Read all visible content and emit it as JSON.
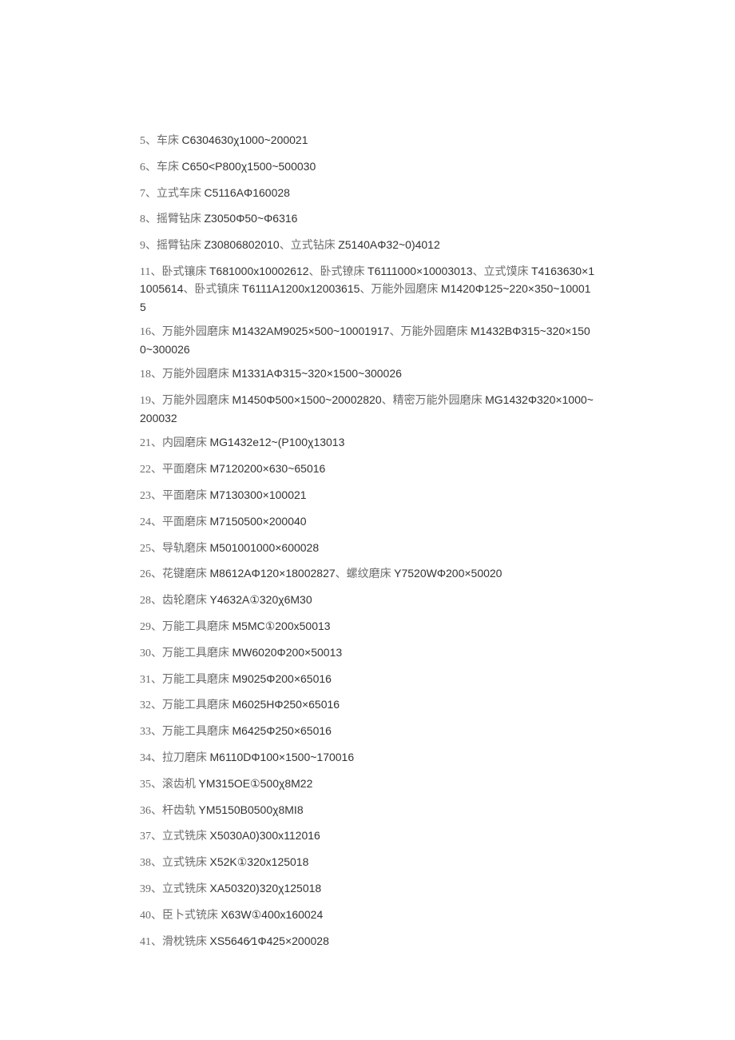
{
  "items": [
    [
      [
        "cn",
        "5、车床 "
      ],
      [
        "latin",
        "C6304630χ1000~200021"
      ]
    ],
    [
      [
        "cn",
        "6、车床 "
      ],
      [
        "latin",
        "C650<P800χ1500~500030"
      ]
    ],
    [
      [
        "cn",
        "7、立式车床 "
      ],
      [
        "latin",
        "C5116AΦ160028"
      ]
    ],
    [
      [
        "cn",
        "8、摇臂钻床 "
      ],
      [
        "latin",
        "Z3050Φ50~Φ6316"
      ]
    ],
    [
      [
        "cn",
        "9、摇臂钻床 "
      ],
      [
        "latin",
        "Z30806802010"
      ],
      [
        "cn",
        "、立式钻床 "
      ],
      [
        "latin",
        "Z5140AΦ32~0)4012"
      ]
    ],
    [
      [
        "cn",
        "11、卧式镶床 "
      ],
      [
        "latin",
        "T681000x10002612"
      ],
      [
        "cn",
        "、卧式镣床 "
      ],
      [
        "latin",
        "T6111000×10003013"
      ],
      [
        "cn",
        "、立式馍床 "
      ],
      [
        "latin",
        "T4163630×11005614"
      ],
      [
        "cn",
        "、卧式镇床 "
      ],
      [
        "latin",
        "T6111A1200x12003615"
      ],
      [
        "cn",
        "、万能外园磨床 "
      ],
      [
        "latin",
        "M1420Φ125~220×350~100015"
      ]
    ],
    [
      [
        "cn",
        "16、万能外园磨床 "
      ],
      [
        "latin",
        "M1432AM9025×500~10001917"
      ],
      [
        "cn",
        "、万能外园磨床 "
      ],
      [
        "latin",
        "M1432BΦ315~320×1500~300026"
      ]
    ],
    [
      [
        "cn",
        "18、万能外园磨床 "
      ],
      [
        "latin",
        "M1331AΦ315~320×1500~300026"
      ]
    ],
    [
      [
        "cn",
        "19、万能外园磨床 "
      ],
      [
        "latin",
        "M1450Φ500×1500~20002820"
      ],
      [
        "cn",
        "、精密万能外园磨床 "
      ],
      [
        "latin",
        "MG1432Φ320×1000~200032"
      ]
    ],
    [
      [
        "cn",
        "21、内园磨床 "
      ],
      [
        "latin",
        "MG1432e12~(P100χ13013"
      ]
    ],
    [
      [
        "cn",
        "22、平面磨床 "
      ],
      [
        "latin",
        "M7120200×630~65016"
      ]
    ],
    [
      [
        "cn",
        "23、平面磨床 "
      ],
      [
        "latin",
        "M7130300×100021"
      ]
    ],
    [
      [
        "cn",
        "24、平面磨床 "
      ],
      [
        "latin",
        "M7150500×200040"
      ]
    ],
    [
      [
        "cn",
        "25、导轨磨床 "
      ],
      [
        "latin",
        "M501001000×600028"
      ]
    ],
    [
      [
        "cn",
        "26、花键磨床 "
      ],
      [
        "latin",
        "M8612AΦ120×18002827"
      ],
      [
        "cn",
        "、螺纹磨床 "
      ],
      [
        "latin",
        "Y7520WΦ200×50020"
      ]
    ],
    [
      [
        "cn",
        "28、齿轮磨床 "
      ],
      [
        "latin",
        "Y4632A①320χ6M30"
      ]
    ],
    [
      [
        "cn",
        "29、万能工具磨床 "
      ],
      [
        "latin",
        "M5MC①200x50013"
      ]
    ],
    [
      [
        "cn",
        "30、万能工具磨床 "
      ],
      [
        "latin",
        "MW6020Φ200×50013"
      ]
    ],
    [
      [
        "cn",
        "31、万能工具磨床 "
      ],
      [
        "latin",
        "M9025Φ200×65016"
      ]
    ],
    [
      [
        "cn",
        "32、万能工具磨床 "
      ],
      [
        "latin",
        "M6025HΦ250×65016"
      ]
    ],
    [
      [
        "cn",
        "33、万能工具磨床 "
      ],
      [
        "latin",
        "M6425Φ250×65016"
      ]
    ],
    [
      [
        "cn",
        "34、拉刀磨床 "
      ],
      [
        "latin",
        "M6110DΦ100×1500~170016"
      ]
    ],
    [
      [
        "cn",
        "35、滚齿机 "
      ],
      [
        "latin",
        "YM315OE①500χ8M22"
      ]
    ],
    [
      [
        "cn",
        "36、杆齿轨 "
      ],
      [
        "latin",
        "YM5150B0500χ8MI8"
      ]
    ],
    [
      [
        "cn",
        "37、立式铣床 "
      ],
      [
        "latin",
        "X5030A0)300x112016"
      ]
    ],
    [
      [
        "cn",
        "38、立式铣床 "
      ],
      [
        "latin",
        "X52K①320x125018"
      ]
    ],
    [
      [
        "cn",
        "39、立式铣床 "
      ],
      [
        "latin",
        "XA50320)320χ125018"
      ]
    ],
    [
      [
        "cn",
        "40、臣卜式铳床 "
      ],
      [
        "latin",
        "X63W①400x160024"
      ]
    ],
    [
      [
        "cn",
        "41、滑枕铣床 "
      ],
      [
        "latin",
        "XS5646⁄1Φ425×200028"
      ]
    ]
  ]
}
